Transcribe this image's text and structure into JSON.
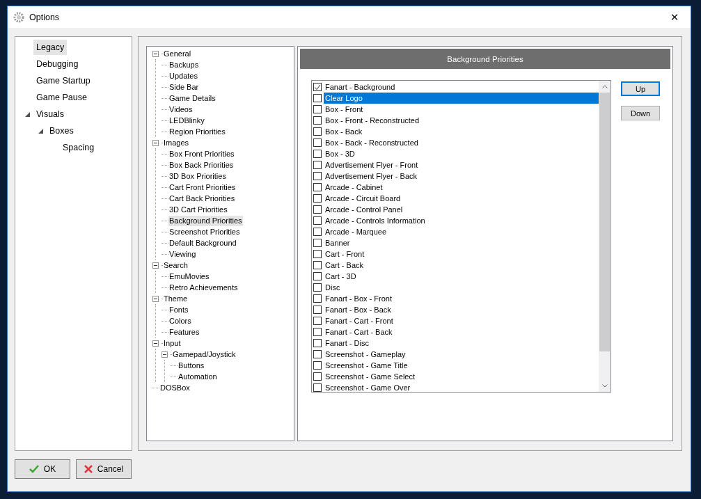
{
  "window": {
    "title": "Options",
    "close": "✕"
  },
  "left_tree": [
    {
      "label": "Legacy",
      "selected": true
    },
    {
      "label": "Debugging",
      "selected": false
    },
    {
      "label": "Game Startup",
      "selected": false
    },
    {
      "label": "Game Pause",
      "selected": false
    },
    {
      "label": "Visuals",
      "selected": false,
      "expanded": true,
      "children": [
        {
          "label": "Boxes",
          "selected": false,
          "expanded": true,
          "children": [
            {
              "label": "Spacing",
              "selected": false
            }
          ]
        }
      ]
    }
  ],
  "settings_tree": [
    {
      "label": "General",
      "selected": false,
      "expanded": true,
      "children": [
        {
          "label": "Backups",
          "selected": false
        },
        {
          "label": "Updates",
          "selected": false
        },
        {
          "label": "Side Bar",
          "selected": false
        },
        {
          "label": "Game Details",
          "selected": false
        },
        {
          "label": "Videos",
          "selected": false
        },
        {
          "label": "LEDBlinky",
          "selected": false
        },
        {
          "label": "Region Priorities",
          "selected": false
        }
      ]
    },
    {
      "label": "Images",
      "selected": false,
      "expanded": true,
      "children": [
        {
          "label": "Box Front Priorities",
          "selected": false
        },
        {
          "label": "Box Back Priorities",
          "selected": false
        },
        {
          "label": "3D Box Priorities",
          "selected": false
        },
        {
          "label": "Cart Front Priorities",
          "selected": false
        },
        {
          "label": "Cart Back Priorities",
          "selected": false
        },
        {
          "label": "3D Cart Priorities",
          "selected": false
        },
        {
          "label": "Background Priorities",
          "selected": true
        },
        {
          "label": "Screenshot Priorities",
          "selected": false
        },
        {
          "label": "Default Background",
          "selected": false
        },
        {
          "label": "Viewing",
          "selected": false
        }
      ]
    },
    {
      "label": "Search",
      "selected": false,
      "expanded": true,
      "children": [
        {
          "label": "EmuMovies",
          "selected": false
        },
        {
          "label": "Retro Achievements",
          "selected": false
        }
      ]
    },
    {
      "label": "Theme",
      "selected": false,
      "expanded": true,
      "children": [
        {
          "label": "Fonts",
          "selected": false
        },
        {
          "label": "Colors",
          "selected": false
        },
        {
          "label": "Features",
          "selected": false
        }
      ]
    },
    {
      "label": "Input",
      "selected": false,
      "expanded": true,
      "children": [
        {
          "label": "Gamepad/Joystick",
          "selected": false,
          "expanded": true,
          "children": [
            {
              "label": "Buttons",
              "selected": false
            },
            {
              "label": "Automation",
              "selected": false
            }
          ]
        }
      ]
    },
    {
      "label": "DOSBox",
      "selected": false
    }
  ],
  "section": {
    "title": "Background Priorities"
  },
  "priorities": [
    {
      "label": "Fanart - Background",
      "checked": true,
      "selected": false
    },
    {
      "label": "Clear Logo",
      "checked": false,
      "selected": true
    },
    {
      "label": "Box - Front",
      "checked": false,
      "selected": false
    },
    {
      "label": "Box - Front - Reconstructed",
      "checked": false,
      "selected": false
    },
    {
      "label": "Box - Back",
      "checked": false,
      "selected": false
    },
    {
      "label": "Box - Back - Reconstructed",
      "checked": false,
      "selected": false
    },
    {
      "label": "Box - 3D",
      "checked": false,
      "selected": false
    },
    {
      "label": "Advertisement Flyer - Front",
      "checked": false,
      "selected": false
    },
    {
      "label": "Advertisement Flyer - Back",
      "checked": false,
      "selected": false
    },
    {
      "label": "Arcade - Cabinet",
      "checked": false,
      "selected": false
    },
    {
      "label": "Arcade - Circuit Board",
      "checked": false,
      "selected": false
    },
    {
      "label": "Arcade - Control Panel",
      "checked": false,
      "selected": false
    },
    {
      "label": "Arcade - Controls Information",
      "checked": false,
      "selected": false
    },
    {
      "label": "Arcade - Marquee",
      "checked": false,
      "selected": false
    },
    {
      "label": "Banner",
      "checked": false,
      "selected": false
    },
    {
      "label": "Cart - Front",
      "checked": false,
      "selected": false
    },
    {
      "label": "Cart - Back",
      "checked": false,
      "selected": false
    },
    {
      "label": "Cart - 3D",
      "checked": false,
      "selected": false
    },
    {
      "label": "Disc",
      "checked": false,
      "selected": false
    },
    {
      "label": "Fanart - Box - Front",
      "checked": false,
      "selected": false
    },
    {
      "label": "Fanart - Box - Back",
      "checked": false,
      "selected": false
    },
    {
      "label": "Fanart - Cart - Front",
      "checked": false,
      "selected": false
    },
    {
      "label": "Fanart - Cart - Back",
      "checked": false,
      "selected": false
    },
    {
      "label": "Fanart - Disc",
      "checked": false,
      "selected": false
    },
    {
      "label": "Screenshot - Gameplay",
      "checked": false,
      "selected": false
    },
    {
      "label": "Screenshot - Game Title",
      "checked": false,
      "selected": false
    },
    {
      "label": "Screenshot - Game Select",
      "checked": false,
      "selected": false
    },
    {
      "label": "Screenshot - Game Over",
      "checked": false,
      "selected": false
    }
  ],
  "side_buttons": [
    {
      "label": "Up",
      "focused": true
    },
    {
      "label": "Down",
      "focused": false
    }
  ],
  "footer_buttons": [
    {
      "label": "OK",
      "kind": "ok"
    },
    {
      "label": "Cancel",
      "kind": "cancel"
    }
  ]
}
